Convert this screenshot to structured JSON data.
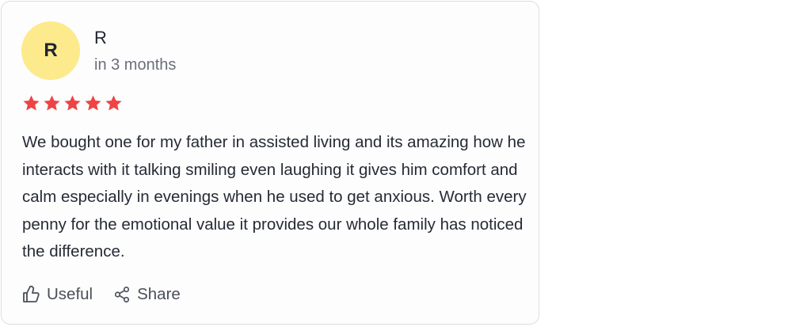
{
  "review": {
    "avatar_letter": "R",
    "author": "R",
    "date": "in 3 months",
    "rating": 5,
    "star_color": "#ee4444",
    "avatar_color": "#fcea8c",
    "text": "We bought one for my father in assisted living and its amazing how he interacts with it talking smiling even laughing it gives him comfort and calm especially in evenings when he used to get anxious. Worth every penny for the emotional value it provides our whole family has noticed the difference.",
    "actions": {
      "useful_label": "Useful",
      "useful_icon": "thumbs-up-icon",
      "share_label": "Share",
      "share_icon": "share-icon"
    }
  }
}
